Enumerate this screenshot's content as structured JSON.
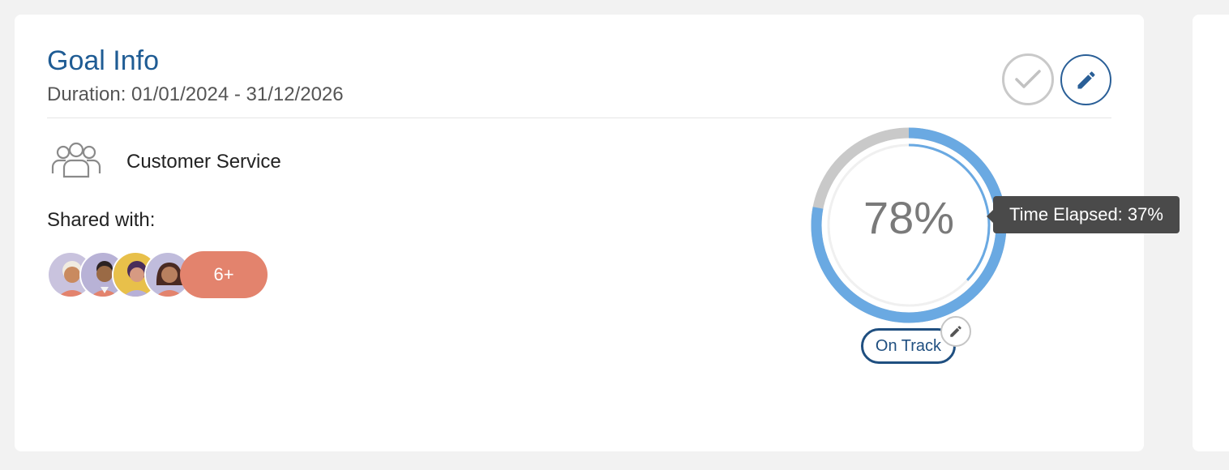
{
  "goal": {
    "title": "Goal Info",
    "duration": "Duration: 01/01/2024 - 31/12/2026"
  },
  "team": {
    "icon": "team-icon",
    "name": "Customer Service"
  },
  "shared": {
    "label": "Shared with:",
    "avatars": [
      "avatar-1",
      "avatar-2",
      "avatar-3",
      "avatar-4"
    ],
    "more": "6+"
  },
  "progress": {
    "value": 78,
    "label": "78%",
    "time_elapsed_fraction": 0.37,
    "tooltip": "Time Elapsed: 37%",
    "status": "On Track"
  },
  "colors": {
    "accent": "#1f5c94",
    "progress": "#6aa9e2",
    "track": "#c9c9c9",
    "more_pill": "#e3836d"
  },
  "actions": {
    "complete_icon": "check-icon",
    "edit_icon": "pencil-icon"
  }
}
